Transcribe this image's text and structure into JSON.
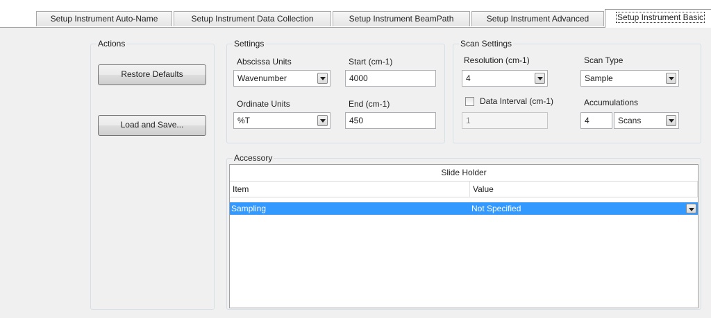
{
  "tabs": [
    {
      "label": "Setup Instrument Auto-Name",
      "active": false
    },
    {
      "label": "Setup Instrument Data Collection",
      "active": false
    },
    {
      "label": "Setup Instrument BeamPath",
      "active": false
    },
    {
      "label": "Setup Instrument Advanced",
      "active": false
    },
    {
      "label": "Setup Instrument Basic",
      "active": true
    }
  ],
  "actions": {
    "title": "Actions",
    "restore_label": "Restore Defaults",
    "load_save_label": "Load and Save..."
  },
  "settings": {
    "title": "Settings",
    "abscissa_label": "Abscissa Units",
    "abscissa_value": "Wavenumber",
    "start_label": "Start (cm-1)",
    "start_value": "4000",
    "ordinate_label": "Ordinate Units",
    "ordinate_value": "%T",
    "end_label": "End (cm-1)",
    "end_value": "450"
  },
  "scan": {
    "title": "Scan Settings",
    "resolution_label": "Resolution (cm-1)",
    "resolution_value": "4",
    "scan_type_label": "Scan Type",
    "scan_type_value": "Sample",
    "data_interval_label": "Data Interval (cm-1)",
    "data_interval_checked": false,
    "data_interval_value": "1",
    "accumulations_label": "Accumulations",
    "accumulations_value": "4",
    "accumulations_unit": "Scans"
  },
  "accessory": {
    "title": "Accessory",
    "header": "Slide Holder",
    "columns": [
      "Item",
      "Value"
    ],
    "rows": [
      {
        "item": "Sampling",
        "value": "Not Specified",
        "selected": true
      }
    ]
  },
  "colors": {
    "selection": "#3399ff",
    "panel_bg": "#f0f0f0"
  }
}
